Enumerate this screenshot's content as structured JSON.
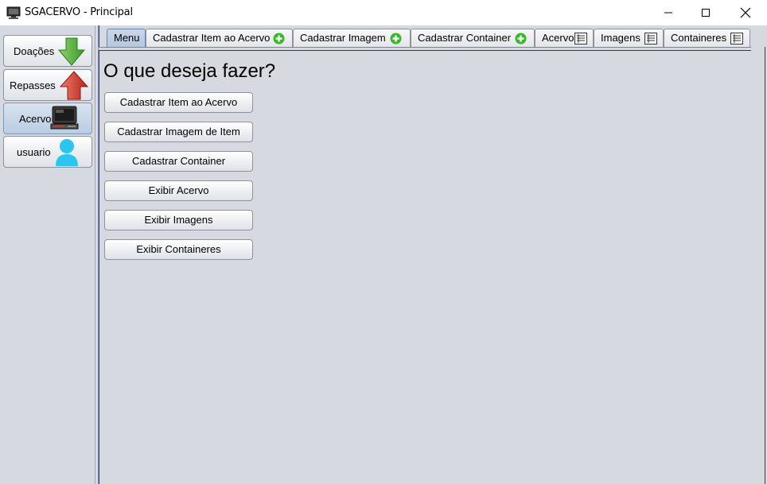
{
  "window": {
    "title": "SGACERVO - Principal",
    "controls": [
      "minimize",
      "maximize",
      "close"
    ]
  },
  "sidebar": {
    "items": [
      {
        "label": "Doações",
        "icon": "green-down-arrow-icon",
        "selected": false
      },
      {
        "label": "Repasses",
        "icon": "red-up-arrow-icon",
        "selected": false
      },
      {
        "label": "Acervo",
        "icon": "computer-icon",
        "selected": true
      },
      {
        "label": "usuario",
        "icon": "user-icon",
        "selected": false
      }
    ]
  },
  "tabs": [
    {
      "label": "Menu",
      "icon": null,
      "selected": true
    },
    {
      "label": "Cadastrar Item ao Acervo",
      "icon": "green-plus-icon",
      "selected": false
    },
    {
      "label": "Cadastrar Imagem",
      "icon": "green-plus-icon",
      "selected": false
    },
    {
      "label": "Cadastrar Container",
      "icon": "green-plus-icon",
      "selected": false
    },
    {
      "label": "Acervo",
      "icon": "list-icon",
      "selected": false
    },
    {
      "label": "Imagens",
      "icon": "list-icon",
      "selected": false
    },
    {
      "label": "Containeres",
      "icon": "list-icon",
      "selected": false
    }
  ],
  "content": {
    "heading": "O que deseja fazer?",
    "buttons": [
      "Cadastrar Item ao Acervo",
      "Cadastrar Imagem de Item",
      "Cadastrar Container",
      "Exibir Acervo",
      "Exibir Imagens",
      "Exibir Containeres"
    ]
  },
  "colors": {
    "panel_bg": "#d6d9df",
    "selected_tab": "#b6c8de",
    "border_dark": "#2a3d6a"
  }
}
